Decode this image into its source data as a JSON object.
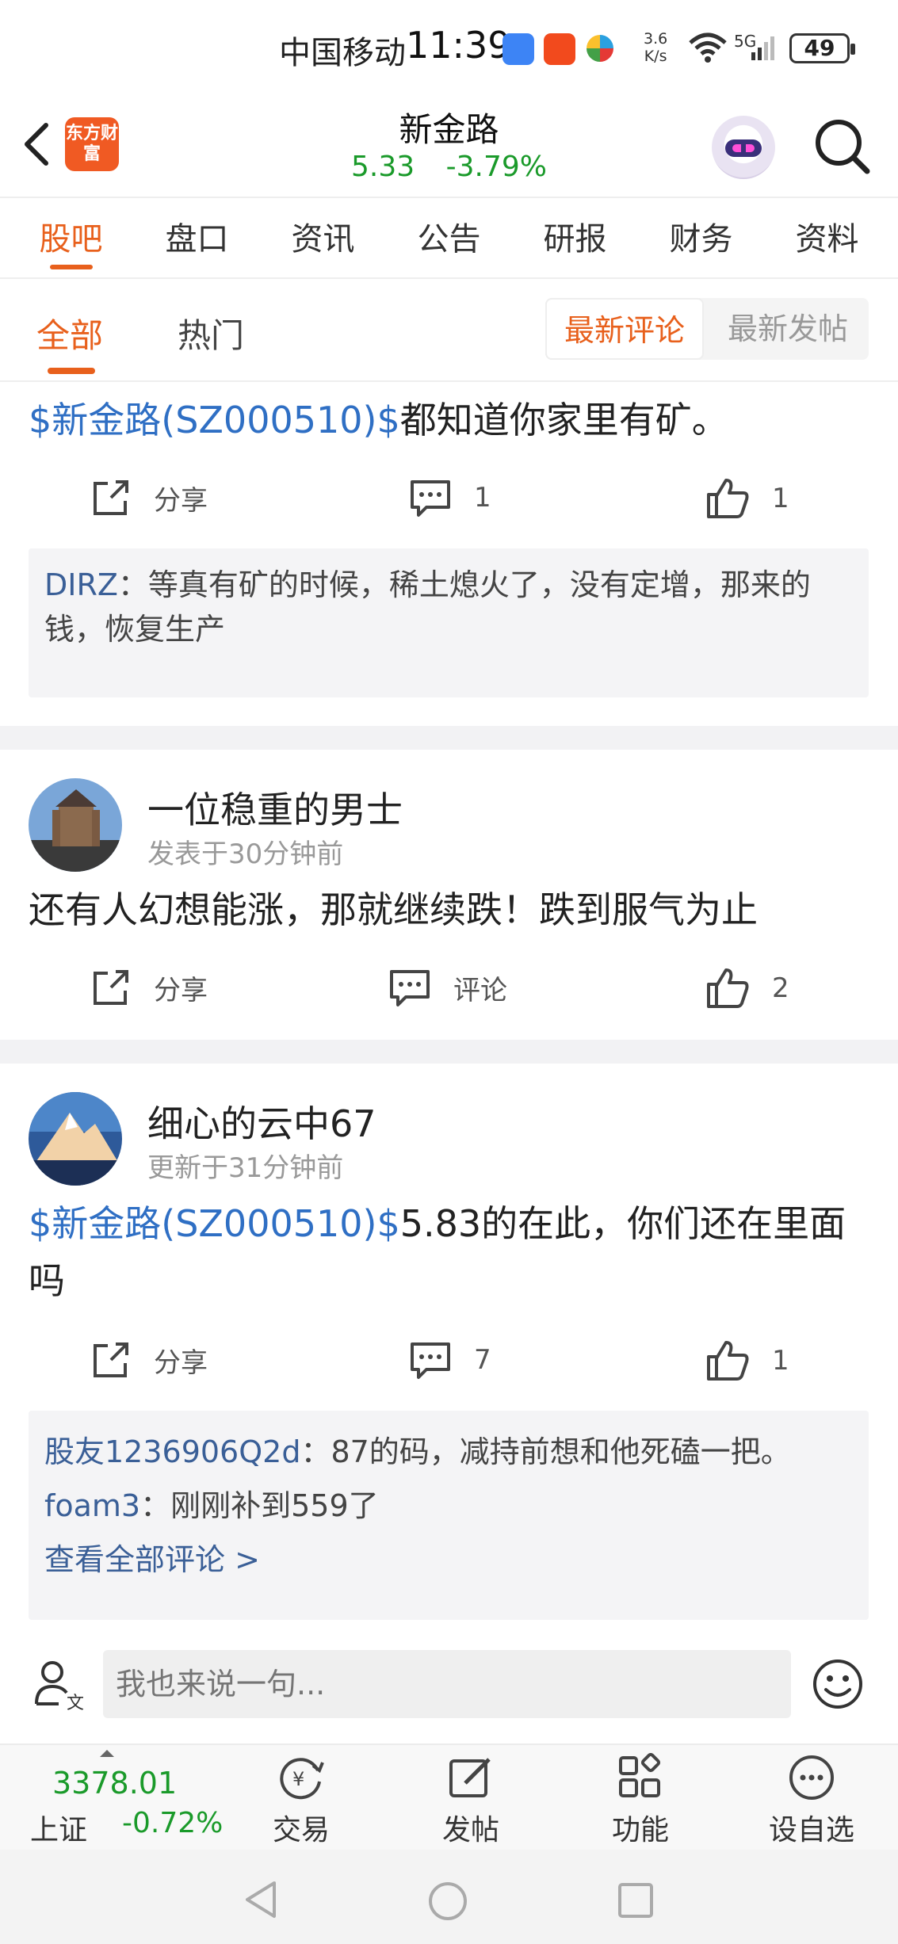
{
  "status_bar": {
    "carrier": "中国移动",
    "time": "11:39",
    "net_speed_value": "3.6",
    "net_speed_unit": "K/s",
    "network": "5G",
    "battery": "49"
  },
  "header": {
    "logo_text": "东方财富",
    "stock_name": "新金路",
    "price": "5.33",
    "change_pct": "-3.79%"
  },
  "tabs": [
    "股吧",
    "盘口",
    "资讯",
    "公告",
    "研报",
    "财务",
    "资料"
  ],
  "subtabs": {
    "all": "全部",
    "hot": "热门",
    "latest_comment": "最新评论",
    "latest_post": "最新发帖"
  },
  "posts": [
    {
      "stock_link": "$新金路(SZ000510)$",
      "content": "都知道你家里有矿。",
      "share_label": "分享",
      "comment_count": "1",
      "like_count": "1",
      "comments": [
        {
          "user": "DIRZ",
          "text": "：等真有矿的时候，稀土熄火了，没有定增，那来的钱，恢复生产"
        }
      ]
    },
    {
      "username": "一位稳重的男士",
      "time": "发表于30分钟前",
      "content": "还有人幻想能涨，那就继续跌！跌到服气为止",
      "share_label": "分享",
      "comment_label": "评论",
      "like_count": "2"
    },
    {
      "username": "细心的云中67",
      "time": "更新于31分钟前",
      "stock_link": "$新金路(SZ000510)$",
      "content": "5.83的在此，你们还在里面吗",
      "share_label": "分享",
      "comment_count": "7",
      "like_count": "1",
      "comments": [
        {
          "user": "股友1236906Q2d",
          "text": "：87的码，减持前想和他死磕一把。"
        },
        {
          "user": "foam3",
          "text": "：刚刚补到559了"
        }
      ],
      "view_all": "查看全部评论 >"
    }
  ],
  "reply": {
    "placeholder": "我也来说一句..."
  },
  "bottom_bar": {
    "index_value": "3378.01",
    "index_name": "上证",
    "index_change": "-0.72%",
    "nav": [
      "交易",
      "发帖",
      "功能",
      "设自选"
    ]
  },
  "colors": {
    "accent": "#e8601c",
    "down_green": "#1a9a2a",
    "link_blue": "#2f6fc4"
  }
}
